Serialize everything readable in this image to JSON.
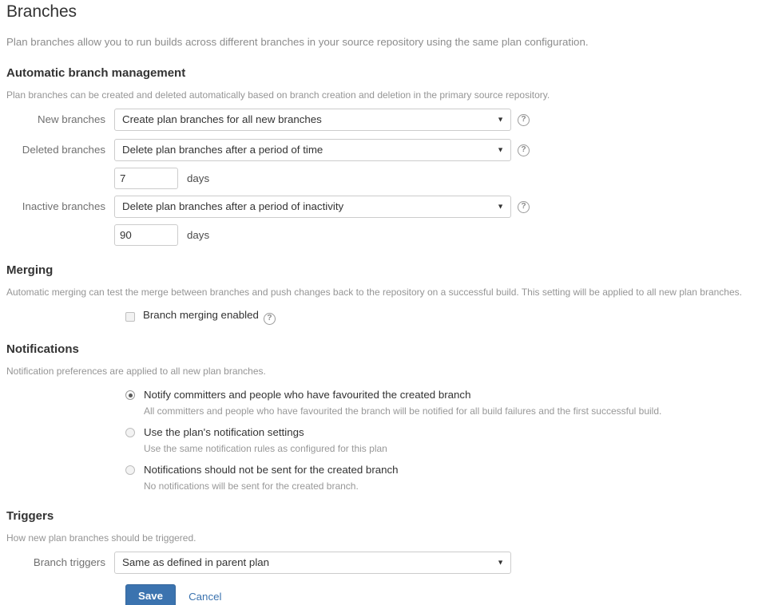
{
  "page": {
    "title": "Branches",
    "intro": "Plan branches allow you to run builds across different branches in your source repository using the same plan configuration."
  },
  "automatic_branch_management": {
    "heading": "Automatic branch management",
    "description": "Plan branches can be created and deleted automatically based on branch creation and deletion in the primary source repository.",
    "new_branches": {
      "label": "New branches",
      "value": "Create plan branches for all new branches",
      "help_icon": "question-circle-icon",
      "caret_icon": "chevron-down-icon"
    },
    "deleted_branches": {
      "label": "Deleted branches",
      "value": "Delete plan branches after a period of time",
      "help_icon": "question-circle-icon",
      "caret_icon": "chevron-down-icon",
      "days_value": "7",
      "days_unit": "days"
    },
    "inactive_branches": {
      "label": "Inactive branches",
      "value": "Delete plan branches after a period of inactivity",
      "help_icon": "question-circle-icon",
      "caret_icon": "chevron-down-icon",
      "days_value": "90",
      "days_unit": "days"
    }
  },
  "merging": {
    "heading": "Merging",
    "description": "Automatic merging can test the merge between branches and push changes back to the repository on a successful build. This setting will be applied to all new plan branches.",
    "checkbox_label": "Branch merging enabled",
    "checkbox_checked": false,
    "help_icon": "question-circle-icon"
  },
  "notifications": {
    "heading": "Notifications",
    "description": "Notification preferences are applied to all new plan branches.",
    "options": [
      {
        "label": "Notify committers and people who have favourited the created branch",
        "help": "All committers and people who have favourited the branch will be notified for all build failures and the first successful build.",
        "selected": true
      },
      {
        "label": "Use the plan's notification settings",
        "help": "Use the same notification rules as configured for this plan",
        "selected": false
      },
      {
        "label": "Notifications should not be sent for the created branch",
        "help": "No notifications will be sent for the created branch.",
        "selected": false
      }
    ]
  },
  "triggers": {
    "heading": "Triggers",
    "description": "How new plan branches should be triggered.",
    "branch_triggers": {
      "label": "Branch triggers",
      "value": "Same as defined in parent plan",
      "caret_icon": "chevron-down-icon"
    }
  },
  "actions": {
    "save_label": "Save",
    "cancel_label": "Cancel"
  },
  "colors": {
    "accent": "#3b73af",
    "heading_text": "#333333",
    "muted_text": "#959595",
    "label_text": "#707070",
    "border": "#cccccc"
  },
  "glyphs": {
    "caret": "▼",
    "question": "?"
  }
}
